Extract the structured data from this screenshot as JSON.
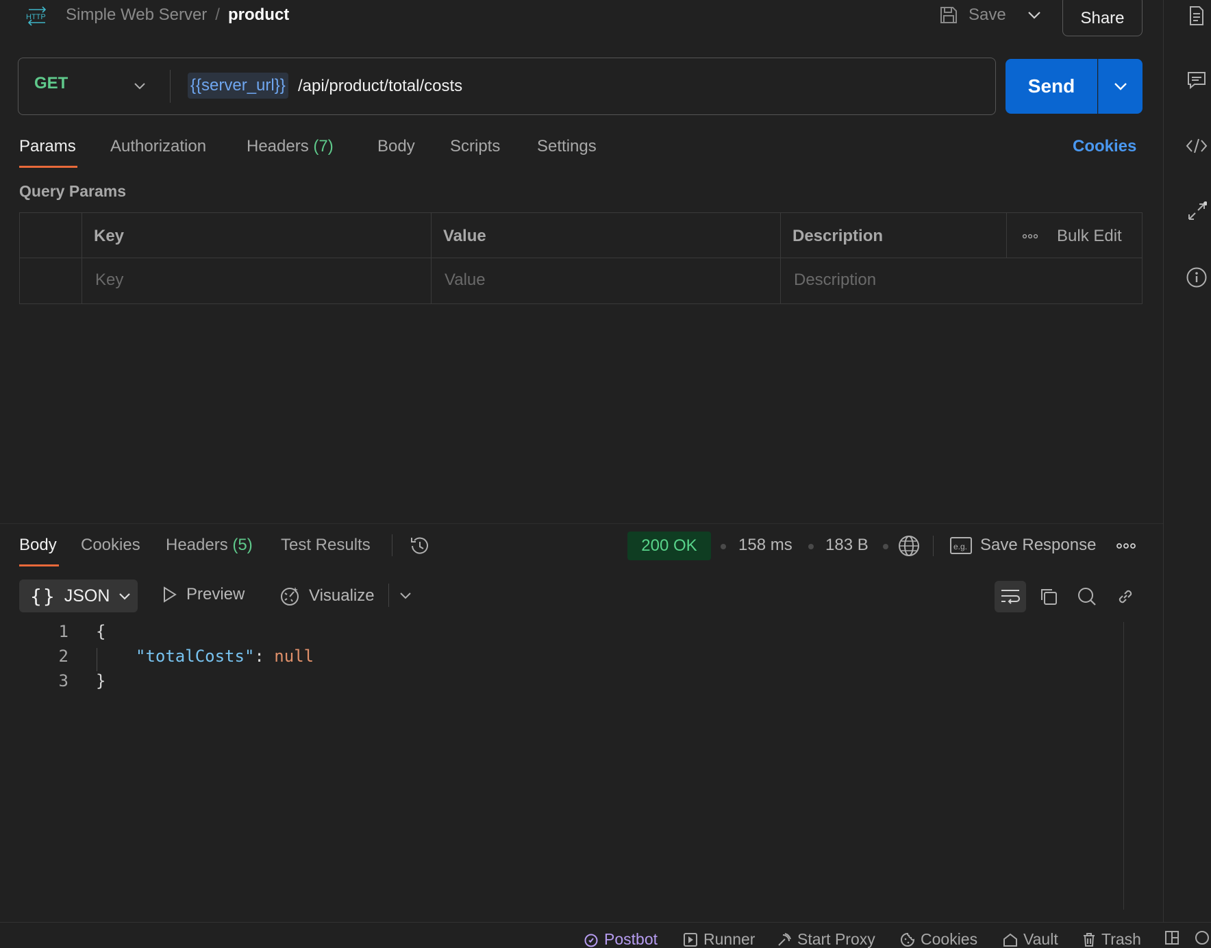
{
  "header": {
    "logo_text": "HTTP",
    "collection": "Simple Web Server",
    "separator": "/",
    "request_name": "product",
    "save_label": "Save",
    "share_label": "Share"
  },
  "request": {
    "method": "GET",
    "url_variable": "{{server_url}}",
    "url_path": "/api/product/total/costs",
    "send_label": "Send",
    "method_color": "#5fc98b"
  },
  "request_tabs": [
    {
      "label": "Params",
      "count": ""
    },
    {
      "label": "Authorization",
      "count": ""
    },
    {
      "label": "Headers",
      "count": "(7)"
    },
    {
      "label": "Body",
      "count": ""
    },
    {
      "label": "Scripts",
      "count": ""
    },
    {
      "label": "Settings",
      "count": ""
    }
  ],
  "cookies_link": "Cookies",
  "query_params": {
    "title": "Query Params",
    "columns": [
      "Key",
      "Value",
      "Description"
    ],
    "placeholders": [
      "Key",
      "Value",
      "Description"
    ],
    "bulk_edit_label": "Bulk Edit"
  },
  "response": {
    "tabs": [
      {
        "label": "Body",
        "count": ""
      },
      {
        "label": "Cookies",
        "count": ""
      },
      {
        "label": "Headers",
        "count": "(5)"
      },
      {
        "label": "Test Results",
        "count": ""
      }
    ],
    "status": "200 OK",
    "time": "158 ms",
    "size": "183 B",
    "save_response_label": "Save Response",
    "format": "JSON",
    "preview_label": "Preview",
    "visualize_label": "Visualize",
    "code_lines": [
      {
        "num": "1",
        "text": "{"
      },
      {
        "num": "2",
        "key": "\"totalCosts\"",
        "colon": ": ",
        "value": "null"
      },
      {
        "num": "3",
        "text": "}"
      }
    ]
  },
  "footer": {
    "items": [
      "Postbot",
      "Runner",
      "Start Proxy",
      "Cookies",
      "Vault",
      "Trash"
    ]
  }
}
